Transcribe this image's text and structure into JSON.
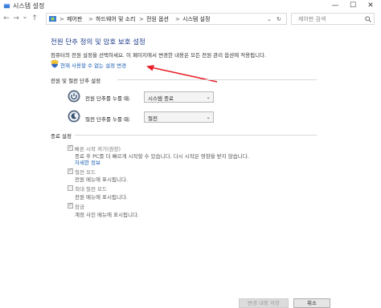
{
  "window": {
    "title": "시스템 설정",
    "minimize_glyph": "—",
    "maximize_glyph": "☐",
    "close_glyph": "✕"
  },
  "nav": {
    "back_glyph": "←",
    "forward_glyph": "→",
    "dropdown_glyph": "⌄",
    "up_glyph": "↑",
    "refresh_glyph": "↻"
  },
  "breadcrumb": {
    "items": [
      "제어판",
      "하드웨어 및 소리",
      "전원 옵션",
      "시스템 설정"
    ],
    "separator": ">"
  },
  "search": {
    "placeholder": "제어판 검색"
  },
  "main": {
    "heading": "전원 단추 정의 및 암호 보호 설정",
    "description": "컴퓨터의 전원 설정을 선택하세요. 이 페이지에서 변경한 내용은 모든 전원 관리 옵션에 적용됩니다.",
    "change_link": "현재 사용할 수 없는 설정 변경"
  },
  "power_section": {
    "title": "전원 및 절전 단추 설정",
    "rows": [
      {
        "label": "전원 단추를 누를 때:",
        "value": "시스템 종료"
      },
      {
        "label": "절전 단추를 누를 때:",
        "value": "절전"
      }
    ]
  },
  "shutdown_section": {
    "title": "종료 설정",
    "options": [
      {
        "label": "빠른 시작 켜기(권장)",
        "checked": true,
        "sub": "종료 후 PC를 더 빠르게 시작할 수 있습니다. 다시 시작은 영향을 받지 않습니다.",
        "link": "자세한 정보"
      },
      {
        "label": "절전 모드",
        "checked": true,
        "sub": "전원 메뉴에 표시됩니다."
      },
      {
        "label": "최대 절전 모드",
        "checked": false,
        "sub": "전원 메뉴에 표시됩니다."
      },
      {
        "label": "잠금",
        "checked": true,
        "sub": "계정 사진 메뉴에 표시됩니다."
      }
    ]
  },
  "footer": {
    "save_label": "변경 내용 저장",
    "cancel_label": "취소"
  },
  "colors": {
    "accent": "#1a5fb4",
    "heading": "#1e3c8c",
    "annotation_arrow": "#e8202a"
  },
  "glyphs": {
    "checkmark": "✓",
    "select_arrow": "⌄"
  }
}
